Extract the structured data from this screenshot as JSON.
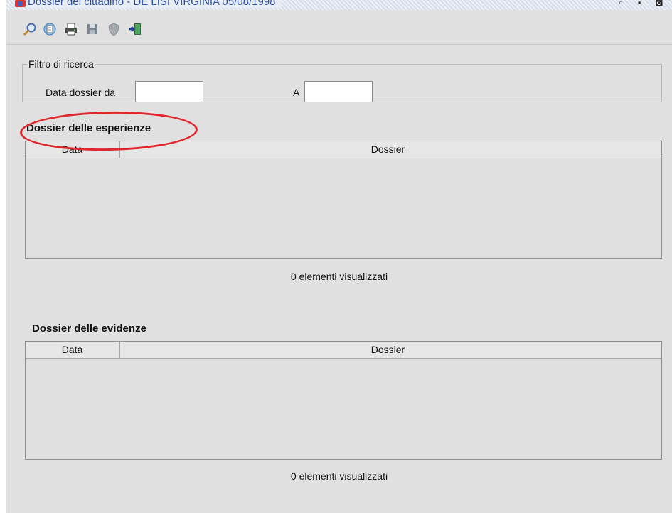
{
  "window": {
    "title": "Dossier del cittadino - DE LISI VIRGINIA 05/08/1998",
    "controls": [
      "▫",
      "▪",
      "⊠"
    ]
  },
  "toolbar": {
    "buttons": [
      {
        "icon": "magnifier-icon"
      },
      {
        "icon": "print-preview-icon"
      },
      {
        "icon": "print-icon"
      },
      {
        "icon": "save-icon"
      },
      {
        "icon": "shield-icon"
      },
      {
        "icon": "exit-icon"
      }
    ]
  },
  "filter": {
    "legend": "Filtro di ricerca",
    "from_label": "Data dossier da",
    "from_value": "",
    "to_label": "A",
    "to_value": ""
  },
  "experiences": {
    "title": "Dossier delle esperienze",
    "columns": [
      "Data",
      "Dossier"
    ],
    "rows": [],
    "count_text": "0 elementi visualizzati"
  },
  "evidences": {
    "title": "Dossier delle evidenze",
    "columns": [
      "Data",
      "Dossier"
    ],
    "rows": [],
    "count_text": "0 elementi visualizzati"
  },
  "colors": {
    "annotation": "#e0262b",
    "title_text": "#2e4fa0",
    "panel_bg": "#e0e0e0"
  }
}
